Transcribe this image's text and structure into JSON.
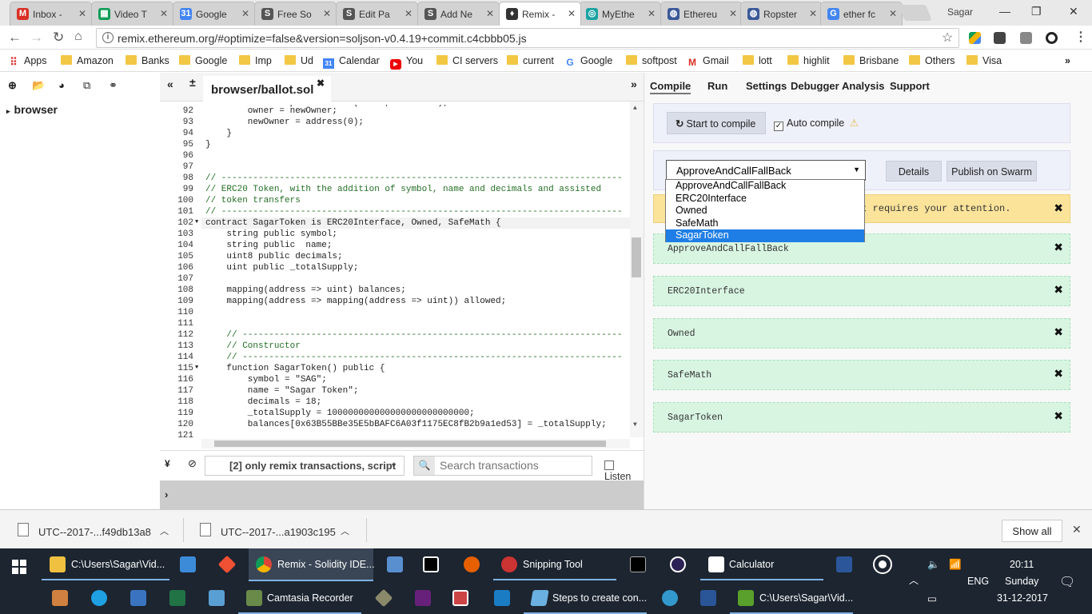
{
  "browser": {
    "tabs": [
      {
        "label": "Inbox -",
        "icon_color": "#d93025",
        "glyph": "M"
      },
      {
        "label": "Video T",
        "icon_color": "#0f9d58",
        "glyph": "▦"
      },
      {
        "label": "Google",
        "icon_color": "#4285f4",
        "glyph": "31"
      },
      {
        "label": "Free So",
        "icon_color": "#555555",
        "glyph": "S"
      },
      {
        "label": "Edit Pa",
        "icon_color": "#555555",
        "glyph": "S"
      },
      {
        "label": "Add Ne",
        "icon_color": "#555555",
        "glyph": "S"
      },
      {
        "label": "Remix -",
        "icon_color": "#333333",
        "glyph": "♦"
      },
      {
        "label": "MyEthe",
        "icon_color": "#1ba3a3",
        "glyph": "◎"
      },
      {
        "label": "Ethereu",
        "icon_color": "#3b5998",
        "glyph": "◍"
      },
      {
        "label": "Ropster",
        "icon_color": "#3b5998",
        "glyph": "◍"
      },
      {
        "label": "ether fc",
        "icon_color": "#4285f4",
        "glyph": "G"
      }
    ],
    "profile": "Sagar",
    "url": "remix.ethereum.org/#optimize=false&version=soljson-v0.4.19+commit.c4cbbb05.js",
    "bookmarks": [
      "Apps",
      "Amazon",
      "Banks",
      "Google",
      "Imp",
      "Ud",
      "Calendar",
      "You",
      "CI servers",
      "current",
      "Google",
      "softpost",
      "Gmail",
      "lott",
      "highlit",
      "Brisbane",
      "Others",
      "Visa"
    ]
  },
  "remix": {
    "file_tree_root": "browser",
    "open_file": "browser/ballot.sol",
    "right_tabs": [
      "Compile",
      "Run",
      "Settings",
      "Debugger",
      "Analysis",
      "Support"
    ],
    "compile": {
      "start_label": "Start to compile",
      "auto_label": "Auto compile",
      "selected_contract": "ApproveAndCallFallBack",
      "details_label": "Details",
      "publish_label": "Publish on Swarm",
      "warning_text": "at requires your attention.",
      "contracts": [
        "ApproveAndCallFallBack",
        "ERC20Interface",
        "Owned",
        "SafeMath",
        "SagarToken"
      ],
      "dropdown_options": [
        "ApproveAndCallFallBack",
        "ERC20Interface",
        "Owned",
        "SafeMath",
        "SagarToken"
      ],
      "dropdown_selected_index": 4
    },
    "terminal": {
      "filter_label": "[2] only remix transactions, script",
      "search_placeholder": "Search transactions",
      "listen_label": "Listen"
    },
    "code": {
      "top_partial": "        ownershipTransferred(owner, newOwner);",
      "lines": [
        {
          "n": "92",
          "t": "        owner = newOwner;"
        },
        {
          "n": "93",
          "t": "        newOwner = address(0);"
        },
        {
          "n": "94",
          "t": "    }"
        },
        {
          "n": "95",
          "t": "}"
        },
        {
          "n": "96",
          "t": ""
        },
        {
          "n": "97",
          "t": ""
        },
        {
          "n": "98",
          "t": "// ----------------------------------------------------------------------------"
        },
        {
          "n": "99",
          "t": "// ERC20 Token, with the addition of symbol, name and decimals and assisted"
        },
        {
          "n": "100",
          "t": "// token transfers"
        },
        {
          "n": "101",
          "t": "// ----------------------------------------------------------------------------"
        },
        {
          "n": "102",
          "t": "contract SagarToken is ERC20Interface, Owned, SafeMath {"
        },
        {
          "n": "103",
          "t": "    string public symbol;"
        },
        {
          "n": "104",
          "t": "    string public  name;"
        },
        {
          "n": "105",
          "t": "    uint8 public decimals;"
        },
        {
          "n": "106",
          "t": "    uint public _totalSupply;"
        },
        {
          "n": "107",
          "t": ""
        },
        {
          "n": "108",
          "t": "    mapping(address => uint) balances;"
        },
        {
          "n": "109",
          "t": "    mapping(address => mapping(address => uint)) allowed;"
        },
        {
          "n": "110",
          "t": ""
        },
        {
          "n": "111",
          "t": ""
        },
        {
          "n": "112",
          "t": "    // ------------------------------------------------------------------------"
        },
        {
          "n": "113",
          "t": "    // Constructor"
        },
        {
          "n": "114",
          "t": "    // ------------------------------------------------------------------------"
        },
        {
          "n": "115",
          "t": "    function SagarToken() public {"
        },
        {
          "n": "116",
          "t": "        symbol = \"SAG\";"
        },
        {
          "n": "117",
          "t": "        name = \"Sagar Token\";"
        },
        {
          "n": "118",
          "t": "        decimals = 18;"
        },
        {
          "n": "119",
          "t": "        _totalSupply = 100000000000000000000000000;"
        },
        {
          "n": "120",
          "t": "        balances[0x63B55BBe35E5bBAFC6A03f1175EC8fB2b9a1ed53] = _totalSupply;"
        },
        {
          "n": "121",
          "t": ""
        }
      ]
    }
  },
  "downloads": {
    "items": [
      "UTC--2017-...f49db13a8",
      "UTC--2017-...a1903c195"
    ],
    "show_all_label": "Show all"
  },
  "taskbar": {
    "explorer1": "C:\\Users\\Sagar\\Vid...",
    "chrome": "Remix - Solidity IDE...",
    "snipping": "Snipping Tool",
    "calculator": "Calculator",
    "camtasia": "Camtasia Recorder",
    "steps": "Steps to create con...",
    "explorer2": "C:\\Users\\Sagar\\Vid...",
    "time": "20:11",
    "day": "Sunday",
    "date": "31-12-2017",
    "lang": "ENG"
  }
}
